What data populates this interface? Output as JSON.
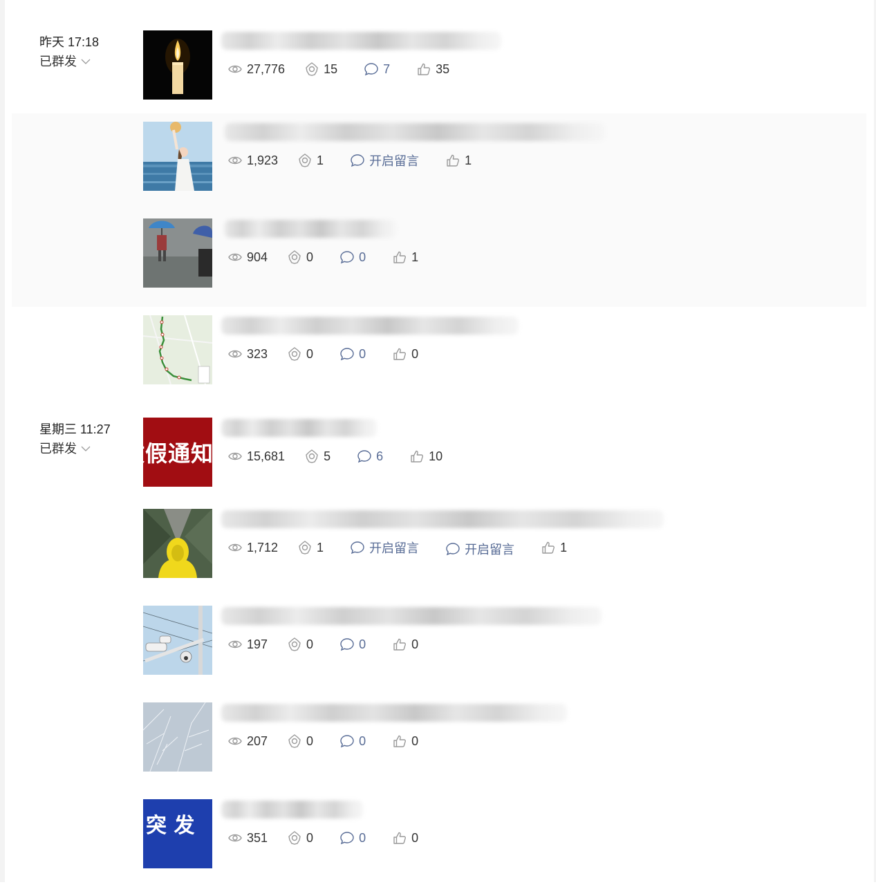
{
  "groups": [
    {
      "time": "昨天 17:18",
      "status": "已群发",
      "articles": [
        {
          "title": "",
          "thumb_icon": "candle-image",
          "views": "27,776",
          "shares": "15",
          "comments": "7",
          "likes": "35"
        },
        {
          "title": "",
          "thumb_icon": "woman-seaside-image",
          "views": "1,923",
          "shares": "1",
          "comments": "开启留言",
          "likes": "1"
        },
        {
          "title": "",
          "thumb_icon": "umbrella-rain-image",
          "views": "904",
          "shares": "0",
          "comments": "0",
          "likes": "1"
        },
        {
          "title": "",
          "thumb_icon": "route-map-image",
          "views": "323",
          "shares": "0",
          "comments": "0",
          "likes": "0"
        }
      ]
    },
    {
      "time": "星期三 11:27",
      "status": "已群发",
      "articles": [
        {
          "title": "",
          "thumb_icon": "holiday-notice-image",
          "thumb_text": "放假通知",
          "views": "15,681",
          "shares": "5",
          "comments": "6",
          "likes": "10"
        },
        {
          "title": "",
          "thumb_icon": "yellow-raincoat-image",
          "views": "1,712",
          "shares": "1",
          "comments": "开启留言",
          "comments_extra": "开启留言",
          "likes": "1"
        },
        {
          "title": "",
          "thumb_icon": "surveillance-camera-image",
          "views": "197",
          "shares": "0",
          "comments": "0",
          "likes": "0"
        },
        {
          "title": "",
          "thumb_icon": "frost-image",
          "views": "207",
          "shares": "0",
          "comments": "0",
          "likes": "0"
        },
        {
          "title": "",
          "thumb_icon": "breaking-news-image",
          "thumb_text": "突 发",
          "views": "351",
          "shares": "0",
          "comments": "0",
          "likes": "0"
        }
      ]
    }
  ],
  "colors": {
    "comment_link": "#576b95",
    "text": "#333333",
    "icon": "#9a9a9a",
    "row_highlight": "#fafafa"
  }
}
